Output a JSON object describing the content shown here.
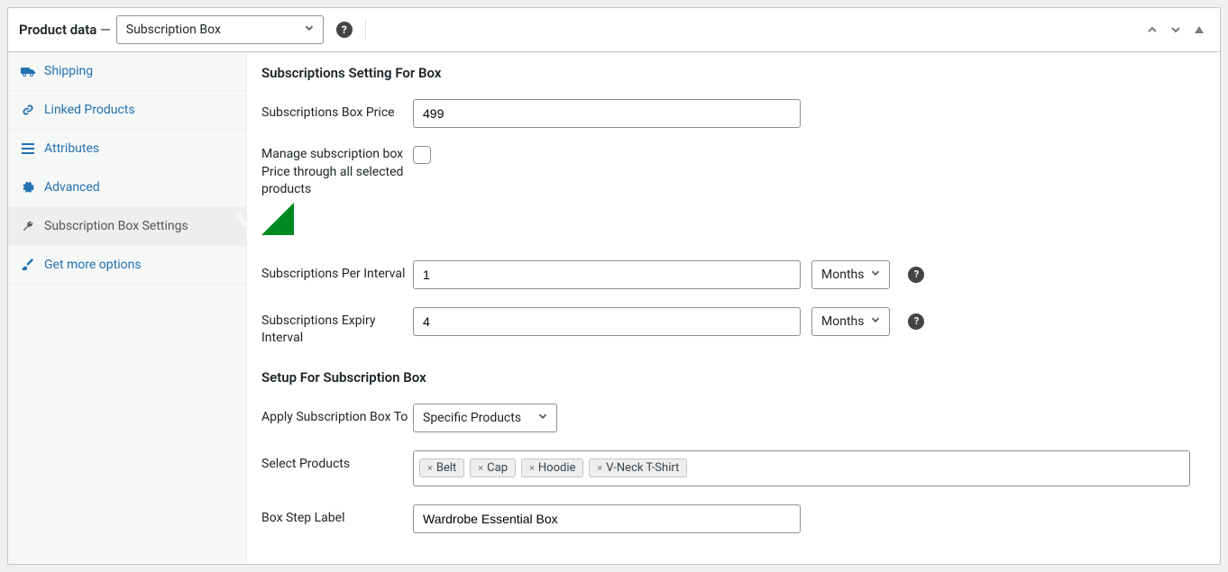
{
  "header": {
    "title_prefix": "Product data",
    "separator": " — ",
    "product_type": "Subscription Box"
  },
  "sidebar": {
    "items": [
      {
        "label": "Shipping",
        "icon": "truck"
      },
      {
        "label": "Linked Products",
        "icon": "link"
      },
      {
        "label": "Attributes",
        "icon": "list"
      },
      {
        "label": "Advanced",
        "icon": "gear"
      },
      {
        "label": "Subscription Box Settings",
        "icon": "wrench",
        "active": true
      },
      {
        "label": "Get more options",
        "icon": "brush"
      }
    ]
  },
  "sections": {
    "subscription_settings_title": "Subscriptions Setting For Box",
    "setup_title": "Setup For Subscription Box"
  },
  "fields": {
    "box_price": {
      "label": "Subscriptions Box Price",
      "value": "499"
    },
    "manage_price": {
      "label": "Manage subscription box Price through all selected products",
      "checked": false
    },
    "pro_label": "Pro",
    "per_interval": {
      "label": "Subscriptions Per Interval",
      "value": "1",
      "unit": "Months"
    },
    "expiry_interval": {
      "label": "Subscriptions Expiry Interval",
      "value": "4",
      "unit": "Months"
    },
    "apply_to": {
      "label": "Apply Subscription Box To",
      "value": "Specific Products"
    },
    "select_products": {
      "label": "Select Products",
      "tags": [
        "Belt",
        "Cap",
        "Hoodie",
        "V-Neck T-Shirt"
      ]
    },
    "step_label": {
      "label": "Box Step Label",
      "value": "Wardrobe Essential Box"
    }
  }
}
